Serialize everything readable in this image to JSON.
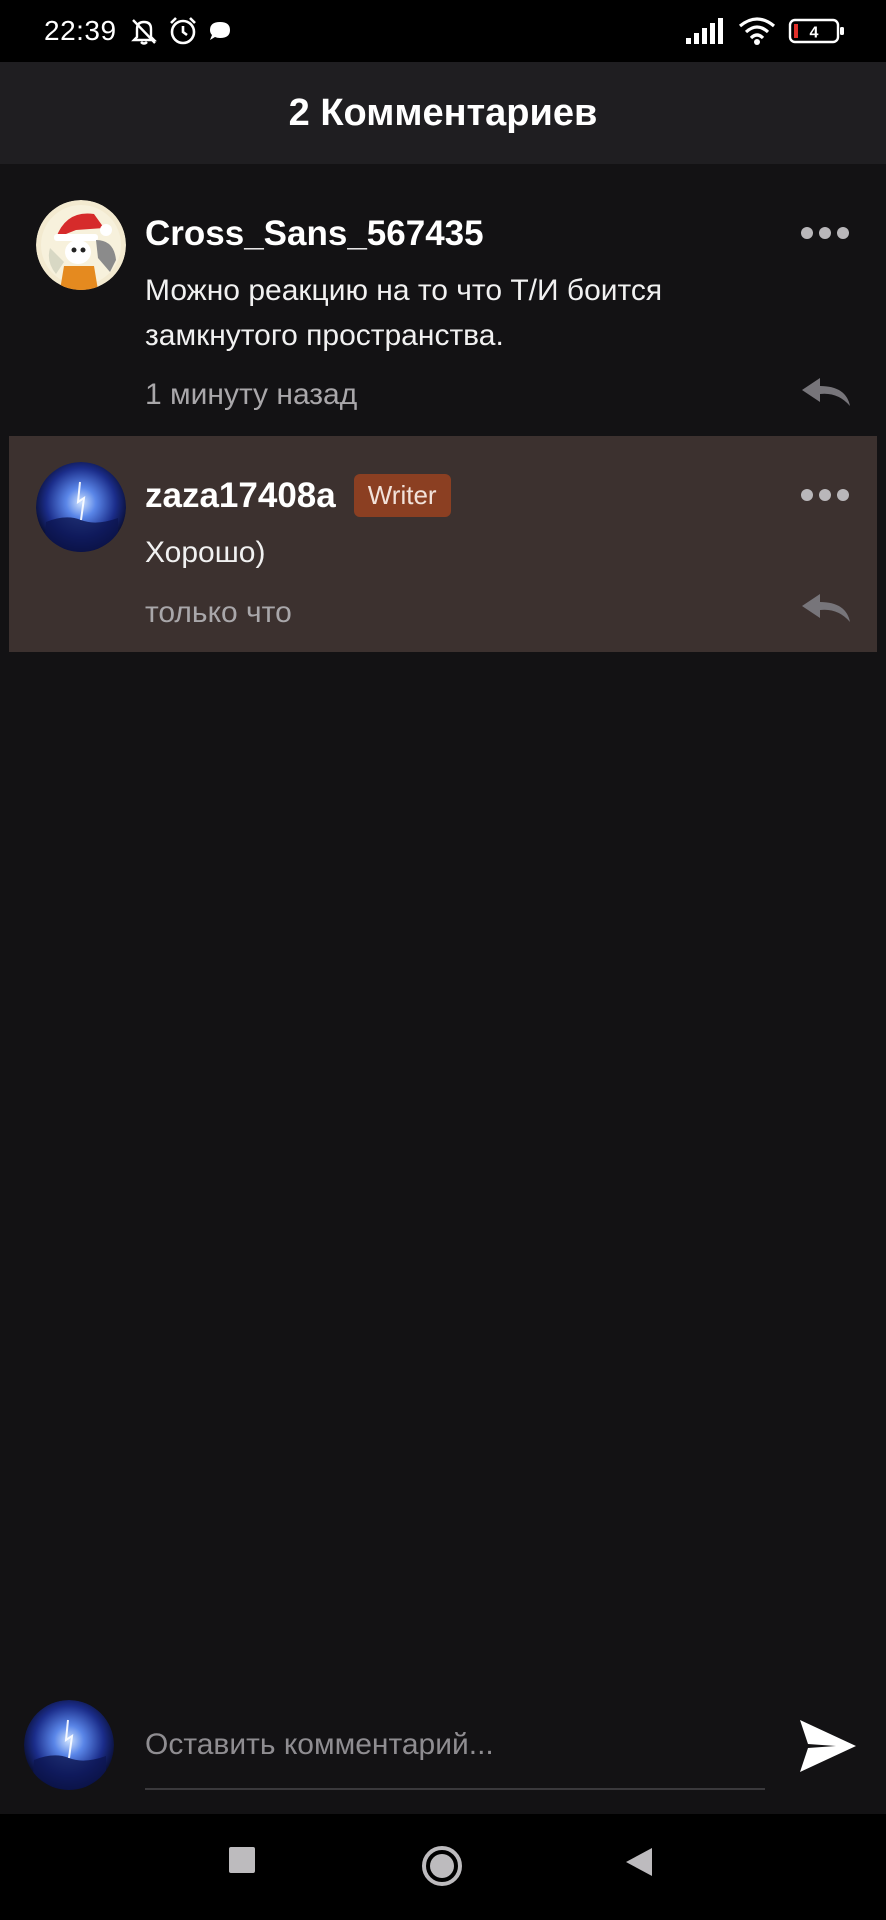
{
  "status_bar": {
    "time": "22:39",
    "battery_level": "4",
    "icons": [
      "bell-off-icon",
      "alarm-icon",
      "chat-bubble-icon",
      "signal-icon",
      "wifi-icon",
      "battery-icon"
    ]
  },
  "header": {
    "title": "2 Комментариев"
  },
  "comments": [
    {
      "author": "Cross_Sans_567435",
      "badge": "",
      "text": "Можно реакцию на то что Т/И боится замкнутого пространства.",
      "time": "1 минуту назад",
      "highlighted": false
    },
    {
      "author": "zaza17408a",
      "badge": "Writer",
      "text": "Хорошо)",
      "time": "только что",
      "highlighted": true
    }
  ],
  "compose": {
    "placeholder": "Оставить комментарий..."
  },
  "colors": {
    "background": "#131214",
    "header_bg": "#1f1e21",
    "highlight_bg": "#3c312f",
    "badge_bg": "#8b3f22",
    "muted_text": "#a9a7aa"
  },
  "nav_bar": {
    "icons": [
      "recents-square-icon",
      "home-circle-icon",
      "back-triangle-icon"
    ]
  }
}
